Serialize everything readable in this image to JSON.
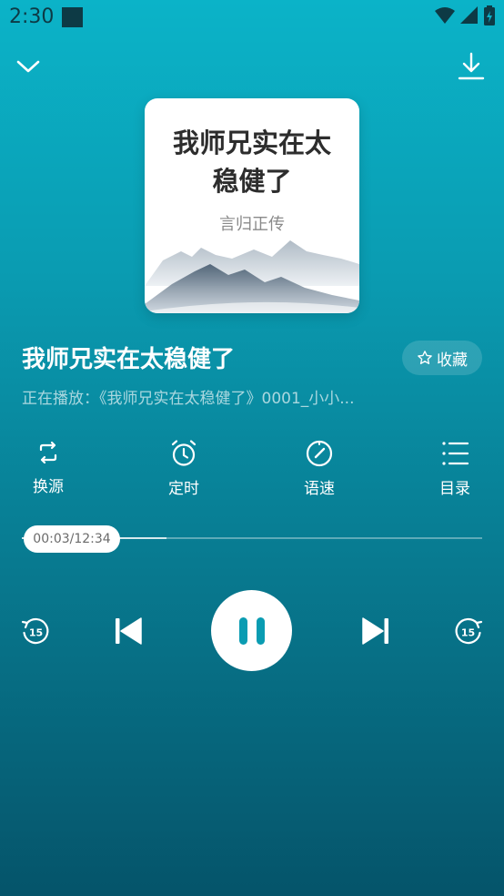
{
  "status_bar": {
    "time": "2:30"
  },
  "book": {
    "cover_title": "我师兄实在太稳健了",
    "cover_author": "言归正传",
    "title": "我师兄实在太稳健了",
    "now_playing": "正在播放：《我师兄实在太稳健了》0001_小小..."
  },
  "favorite": {
    "label": "收藏"
  },
  "tools": [
    {
      "label": "换源",
      "icon": "swap-source-icon"
    },
    {
      "label": "定时",
      "icon": "alarm-clock-icon"
    },
    {
      "label": "语速",
      "icon": "speed-gauge-icon"
    },
    {
      "label": "目录",
      "icon": "list-icon"
    }
  ],
  "progress": {
    "time_text": "00:03/12:34",
    "fraction": 0.004
  },
  "controls": {
    "rewind_seconds": "15",
    "forward_seconds": "15"
  },
  "colors": {
    "bg_top": "#0bb3c8",
    "bg_bottom": "#05546a",
    "accent": "#0a9cb2"
  }
}
